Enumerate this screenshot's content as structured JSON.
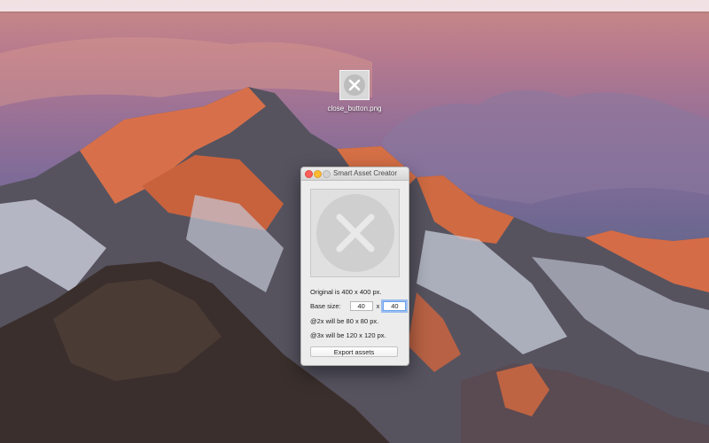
{
  "desktop": {
    "file_name": "close_button.png",
    "icons": {
      "file_thumbnail": "close-x-icon"
    }
  },
  "window": {
    "title": "Smart Asset Creator",
    "traffic_lights": {
      "close": "#fc5f57",
      "minimize": "#fdbc2e",
      "zoom": "#d3d3d3"
    },
    "preview_icon": "close-x-icon",
    "original_text": "Original is 400 x 400 px.",
    "base_size_label": "Base size:",
    "width_value": "40",
    "times_label": "x",
    "height_value": "40",
    "at2x_text": "@2x will be 80 x 80 px.",
    "at3x_text": "@3x will be 120 x 120 px.",
    "export_label": "Export assets"
  }
}
